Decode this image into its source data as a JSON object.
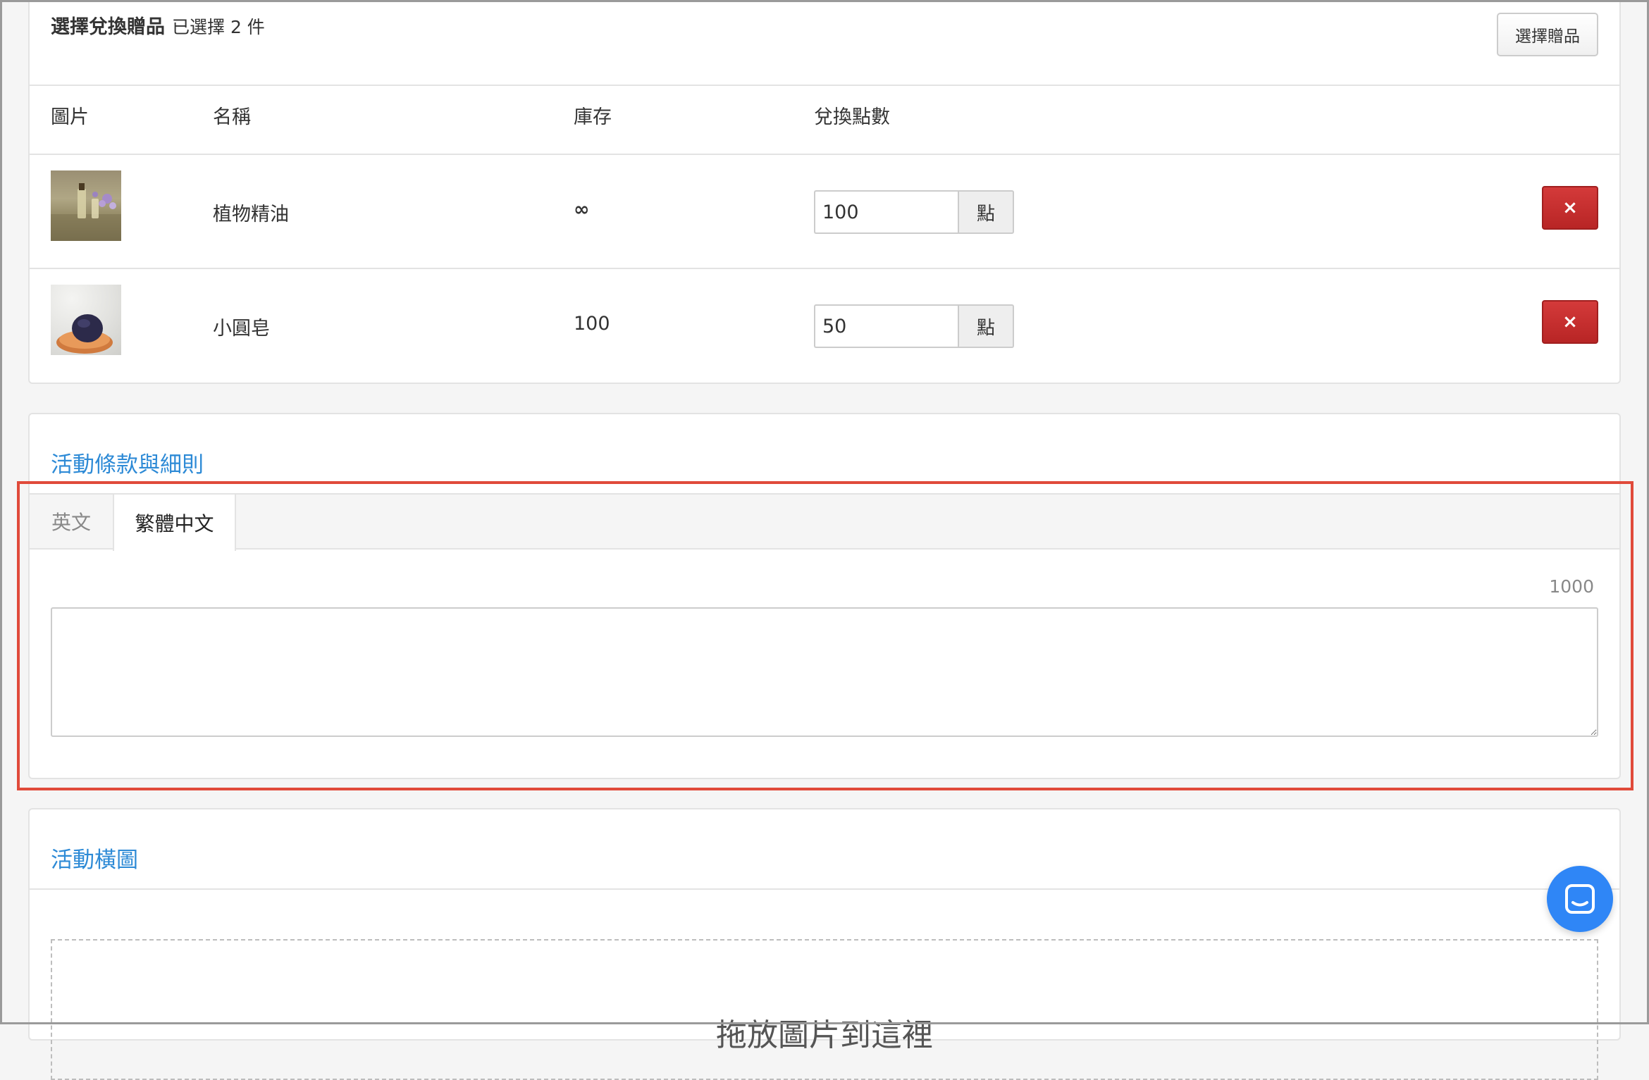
{
  "gifts": {
    "title": "選擇兌換贈品",
    "selected_count": "已選擇 2 件",
    "choose_button": "選擇贈品",
    "columns": [
      "圖片",
      "名稱",
      "庫存",
      "兌換點數"
    ],
    "items": [
      {
        "name": "植物精油",
        "stock": "∞",
        "points": "100",
        "points_unit": "點",
        "delete_label": "×"
      },
      {
        "name": "小圓皂",
        "stock": "100",
        "points": "50",
        "points_unit": "點",
        "delete_label": "×"
      }
    ]
  },
  "terms": {
    "title": "活動條款與細則",
    "tabs": [
      {
        "label": "英文",
        "active": false
      },
      {
        "label": "繁體中文",
        "active": true
      }
    ],
    "char_limit": "1000",
    "textarea_value": ""
  },
  "banner": {
    "title": "活動橫圖",
    "dropzone_text": "拖放圖片到這裡"
  },
  "colors": {
    "accent": "#2d8ad6",
    "danger": "#c12e2e",
    "highlight": "#e04a3a",
    "chat": "#2f86f6"
  },
  "icons": {
    "delete": "close-icon",
    "chat": "chat-icon",
    "resize": "resize-grip-icon"
  }
}
